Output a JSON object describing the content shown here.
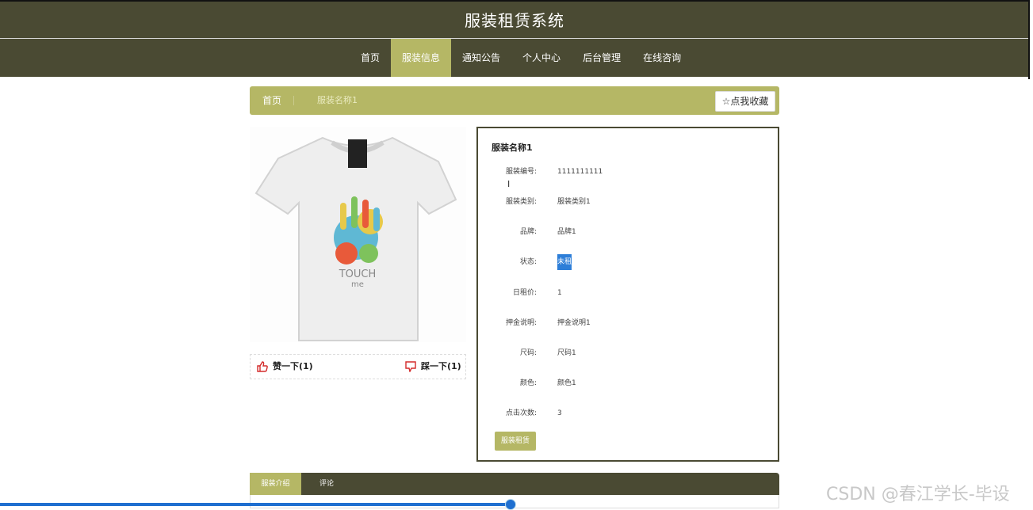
{
  "header": {
    "title": "服装租赁系统"
  },
  "nav": {
    "items": [
      {
        "label": "首页"
      },
      {
        "label": "服装信息"
      },
      {
        "label": "通知公告"
      },
      {
        "label": "个人中心"
      },
      {
        "label": "后台管理"
      },
      {
        "label": "在线咨询"
      }
    ],
    "active_index": 1
  },
  "breadcrumb": {
    "home": "首页",
    "current": "服装名称1"
  },
  "favorite_button": {
    "icon": "star-outline-icon",
    "label": "☆点我收藏"
  },
  "product": {
    "image": {
      "description_icon": "tshirt-image",
      "print_text_1": "TOUCH",
      "print_text_2": "me"
    },
    "like": {
      "icon": "thumbs-up-icon",
      "label": "赞一下(1)"
    },
    "dislike": {
      "icon": "thumbs-down-icon",
      "label": "踩一下(1)"
    }
  },
  "info": {
    "title": "服装名称1",
    "fields": [
      {
        "label": "服装编号:",
        "value": "1111111111"
      },
      {
        "label": "服装类别:",
        "value": "服装类别1"
      },
      {
        "label": "品牌:",
        "value": "品牌1"
      },
      {
        "label": "状态:",
        "value": "未租"
      },
      {
        "label": "日租价:",
        "value": "1"
      },
      {
        "label": "押金说明:",
        "value": "押金说明1"
      },
      {
        "label": "尺码:",
        "value": "尺码1"
      },
      {
        "label": "颜色:",
        "value": "颜色1"
      },
      {
        "label": "点击次数:",
        "value": "3"
      }
    ],
    "rent_button": "服装租赁"
  },
  "tabs": [
    {
      "label": "服装介绍"
    },
    {
      "label": "评论"
    }
  ],
  "overlay": {
    "watermark": "CSDN @春江学长-毕设"
  },
  "colors": {
    "dark": "#4a4a33",
    "accent": "#b5b765",
    "selection": "#2d7ed8"
  }
}
